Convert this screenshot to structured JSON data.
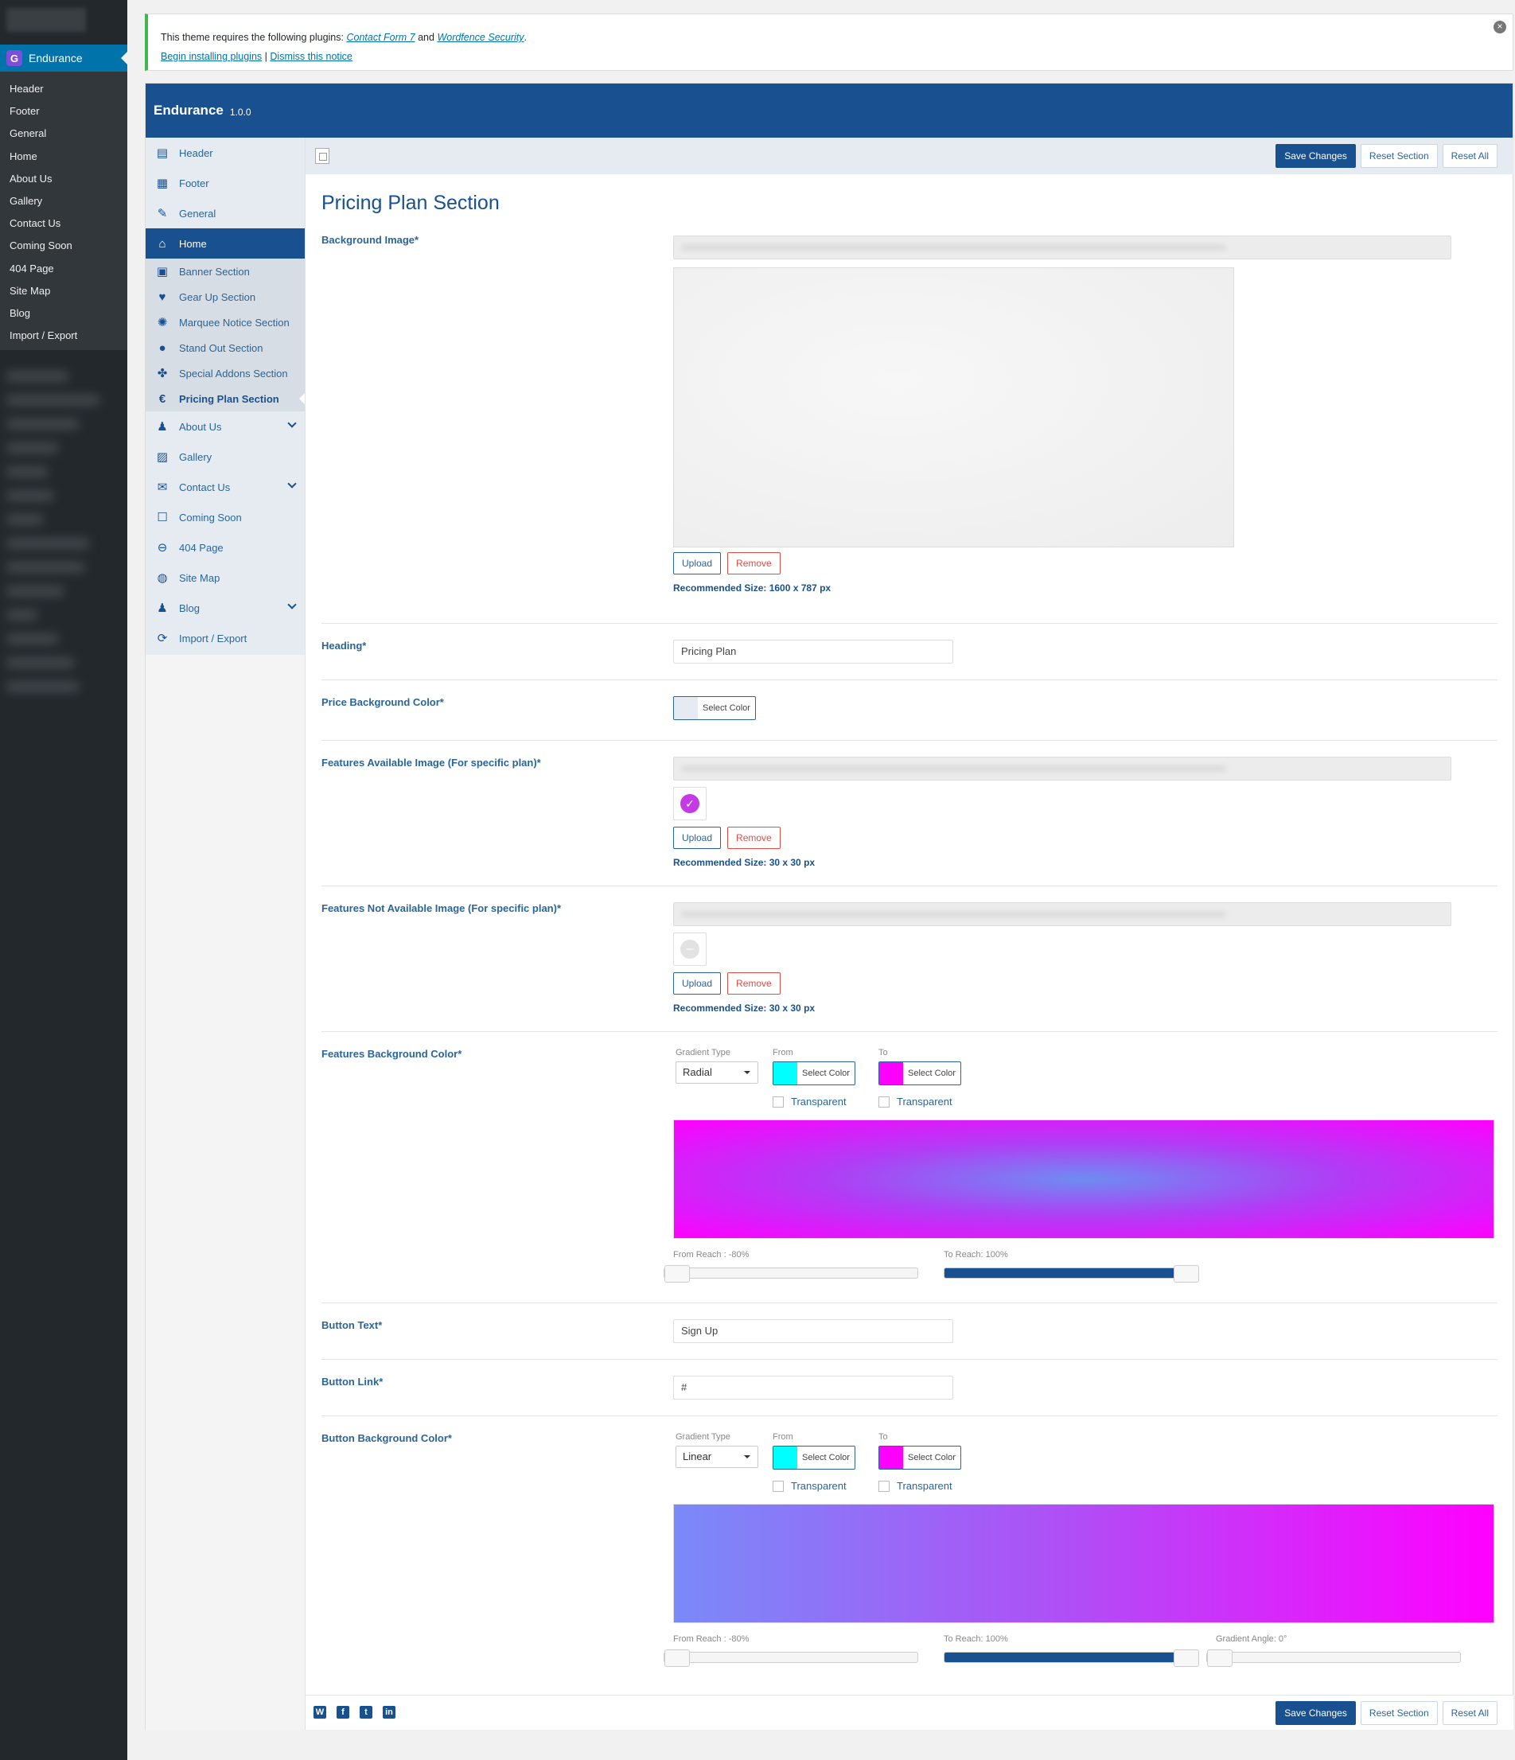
{
  "wp_menu": {
    "active": "Endurance",
    "submenu": [
      "Header",
      "Footer",
      "General",
      "Home",
      "About Us",
      "Gallery",
      "Contact Us",
      "Coming Soon",
      "404 Page",
      "Site Map",
      "Blog",
      "Import / Export"
    ]
  },
  "notice": {
    "text_prefix": "This theme requires the following plugins:",
    "plugin1": "Contact Form 7",
    "and": "and",
    "plugin2": "Wordfence Security",
    "period": ".",
    "begin": "Begin installing plugins",
    "sep": "|",
    "dismiss": "Dismiss this notice"
  },
  "panel": {
    "title": "Endurance",
    "version": "1.0.0"
  },
  "toolbar": {
    "save": "Save Changes",
    "reset_section": "Reset Section",
    "reset_all": "Reset All"
  },
  "nav": [
    {
      "label": "Header",
      "icon": "header-icon"
    },
    {
      "label": "Footer",
      "icon": "footer-icon"
    },
    {
      "label": "General",
      "icon": "wrench-icon"
    },
    {
      "label": "Home",
      "icon": "home-icon"
    },
    {
      "label": "Banner Section",
      "icon": "banner-icon"
    },
    {
      "label": "Gear Up Section",
      "icon": "heart-icon"
    },
    {
      "label": "Marquee Notice Section",
      "icon": "bulb-icon"
    },
    {
      "label": "Stand Out Section",
      "icon": "headphones-icon"
    },
    {
      "label": "Special Addons Section",
      "icon": "puzzle-icon"
    },
    {
      "label": "Pricing Plan Section",
      "icon": "euro-icon"
    },
    {
      "label": "About Us",
      "icon": "user-icon"
    },
    {
      "label": "Gallery",
      "icon": "image-icon"
    },
    {
      "label": "Contact Us",
      "icon": "envelope-icon"
    },
    {
      "label": "Coming Soon",
      "icon": "square-icon"
    },
    {
      "label": "404 Page",
      "icon": "minus-circle-icon"
    },
    {
      "label": "Site Map",
      "icon": "globe-icon"
    },
    {
      "label": "Blog",
      "icon": "user-icon"
    },
    {
      "label": "Import / Export",
      "icon": "refresh-icon"
    }
  ],
  "section_title": "Pricing Plan Section",
  "fields": {
    "bg_image": {
      "label": "Background Image*",
      "upload": "Upload",
      "remove": "Remove",
      "rec": "Recommended Size: 1600 x 787 px"
    },
    "heading": {
      "label": "Heading*",
      "value": "Pricing Plan"
    },
    "price_bg": {
      "label": "Price Background Color*",
      "btn": "Select Color",
      "color": "#e6ebf3"
    },
    "feat_avail": {
      "label": "Features Available Image (For specific plan)*",
      "upload": "Upload",
      "remove": "Remove",
      "rec": "Recommended Size: 30 x 30 px"
    },
    "feat_not": {
      "label": "Features Not Available Image (For specific plan)*",
      "upload": "Upload",
      "remove": "Remove",
      "rec": "Recommended Size: 30 x 30 px"
    },
    "feat_bg": {
      "label": "Features Background Color*",
      "gradient_type_label": "Gradient Type",
      "gradient_type": "Radial",
      "from_label": "From",
      "to_label": "To",
      "select": "Select Color",
      "transparent": "Transparent",
      "from_color": "#00ffff",
      "to_color": "#ff00ff",
      "from_reach_label": "From Reach :",
      "from_reach": "-80%",
      "to_reach_label": "To Reach:",
      "to_reach": "100%"
    },
    "btn_text": {
      "label": "Button Text*",
      "value": "Sign Up"
    },
    "btn_link": {
      "label": "Button Link*",
      "value": "#"
    },
    "btn_bg": {
      "label": "Button Background Color*",
      "gradient_type_label": "Gradient Type",
      "gradient_type": "Linear",
      "from_label": "From",
      "to_label": "To",
      "select": "Select Color",
      "transparent": "Transparent",
      "from_color": "#00ffff",
      "to_color": "#ff00ff",
      "from_reach_label": "From Reach :",
      "from_reach": "-80%",
      "to_reach_label": "To Reach:",
      "to_reach": "100%",
      "angle_label": "Gradient Angle:",
      "angle": "0°"
    }
  },
  "colors": {
    "brand": "#19508f",
    "accent": "#0073aa",
    "remove": "#e14d43"
  }
}
